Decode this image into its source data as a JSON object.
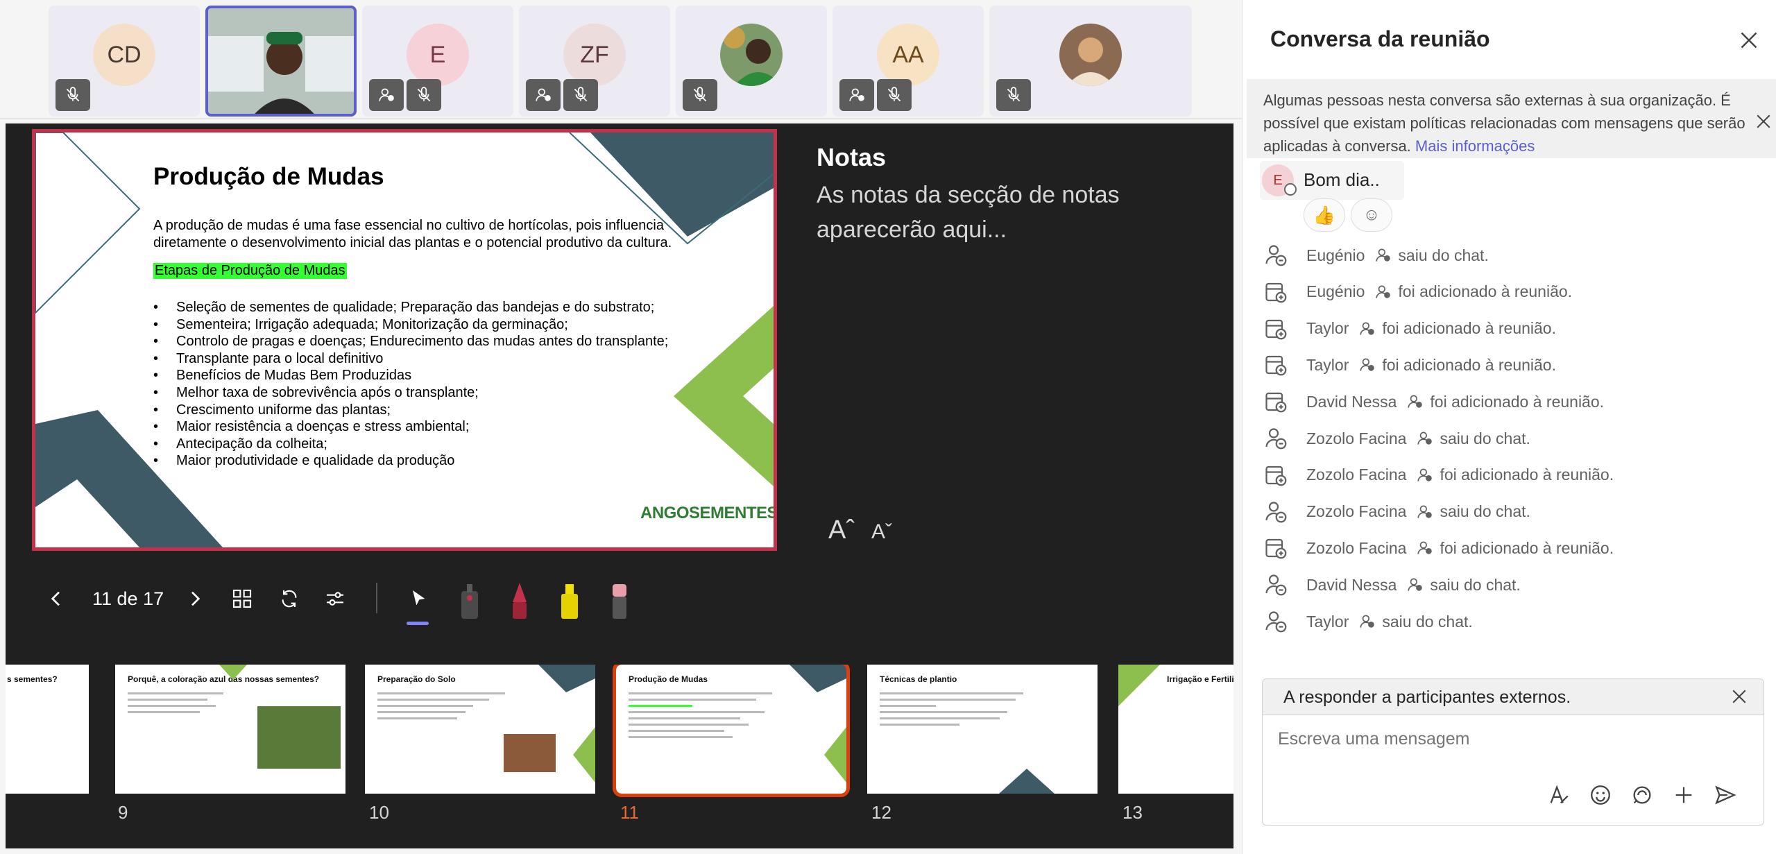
{
  "participants": [
    {
      "initials": "CD",
      "color": "#f6dfc9",
      "video": false
    },
    {
      "initials": "",
      "color": "#9ca8a0",
      "video": true
    },
    {
      "initials": "E",
      "color": "#f6d1d7",
      "video": false
    },
    {
      "initials": "ZF",
      "color": "#eddcdc",
      "video": false
    },
    {
      "initials": "",
      "color": "#7d9a6a",
      "video": true
    },
    {
      "initials": "AA",
      "color": "#f7e3c3",
      "video": false
    },
    {
      "initials": "",
      "color": "#7a5a45",
      "video": true
    }
  ],
  "slide": {
    "title": "Produção de Mudas",
    "intro": "A produção de mudas é uma fase essencial no cultivo de hortícolas, pois influencia diretamente o desenvolvimento inicial das plantas e o potencial produtivo da cultura.",
    "section": "Etapas de Produção de Mudas",
    "bullets": [
      "Seleção de sementes de qualidade; Preparação das bandejas e do substrato;",
      "Sementeira; Irrigação adequada; Monitorização da germinação;",
      "Controlo de pragas e doenças; Endurecimento das mudas antes do transplante;",
      "Transplante para o local definitivo",
      "Benefícios de Mudas Bem Produzidas",
      "Melhor taxa de sobrevivência após o transplante;",
      "Crescimento uniforme das plantas;",
      "Maior resistência a doenças e stress ambiental;",
      "Antecipação da colheita;",
      "Maior produtividade e qualidade da produção"
    ],
    "logo": "ANGOSEMENTES"
  },
  "notes": {
    "title": "Notas",
    "body": "As notas da secção de notas aparecerão aqui..."
  },
  "font_controls": {
    "increase": "Aˆ",
    "decrease": "Aˇ"
  },
  "controls": {
    "page_counter": "11 de 17"
  },
  "thumbnails": [
    {
      "number": "",
      "title": "s sementes?"
    },
    {
      "number": "9",
      "title": "Porquê, a coloração azul das nossas sementes?"
    },
    {
      "number": "10",
      "title": "Preparação do Solo"
    },
    {
      "number": "11",
      "title": "Produção de Mudas"
    },
    {
      "number": "12",
      "title": "Técnicas de plantio"
    },
    {
      "number": "13",
      "title": "Irrigação e Fertiliz"
    }
  ],
  "chat": {
    "title": "Conversa da reunião",
    "banner_text": "Algumas pessoas nesta conversa são externas à sua organização. É possível que existam políticas relacionadas com mensagens que serão aplicadas à conversa.",
    "banner_link": "Mais informações",
    "message": {
      "avatar": "E",
      "text": "Bom dia.."
    },
    "reactions": [
      "👍",
      "☺"
    ],
    "events": [
      {
        "name": "Eugénio",
        "action": "saiu do chat.",
        "kind": "left"
      },
      {
        "name": "Eugénio",
        "action": "foi adicionado à reunião.",
        "kind": "added"
      },
      {
        "name": "Taylor",
        "action": "foi adicionado à reunião.",
        "kind": "added"
      },
      {
        "name": "Taylor",
        "action": "foi adicionado à reunião.",
        "kind": "added"
      },
      {
        "name": "David Nessa",
        "action": "foi adicionado à reunião.",
        "kind": "added"
      },
      {
        "name": "Zozolo Facina",
        "action": "saiu do chat.",
        "kind": "left"
      },
      {
        "name": "Zozolo Facina",
        "action": "foi adicionado à reunião.",
        "kind": "added"
      },
      {
        "name": "Zozolo Facina",
        "action": "saiu do chat.",
        "kind": "left"
      },
      {
        "name": "Zozolo Facina",
        "action": "foi adicionado à reunião.",
        "kind": "added"
      },
      {
        "name": "David Nessa",
        "action": "saiu do chat.",
        "kind": "left"
      },
      {
        "name": "Taylor",
        "action": "saiu do chat.",
        "kind": "left"
      }
    ],
    "reply_header": "A responder a participantes externos.",
    "input_placeholder": "Escreva uma mensagem"
  },
  "colors": {
    "accent": "#5b5fc7",
    "selected_slide": "#d9400d",
    "slide_border": "#c4314b",
    "highlight": "#33ff33"
  }
}
